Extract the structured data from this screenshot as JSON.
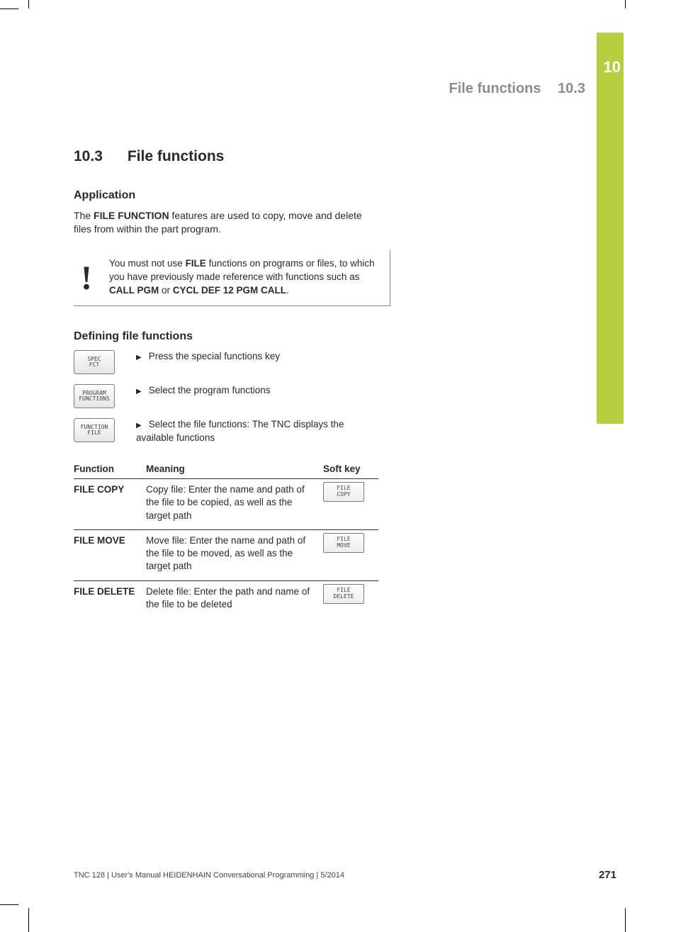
{
  "chapter_tab_number": "10",
  "running_head": {
    "title": "File functions",
    "number": "10.3"
  },
  "section": {
    "number": "10.3",
    "title": "File functions"
  },
  "application": {
    "heading": "Application",
    "intro_pre": "The ",
    "intro_bold": "FILE FUNCTION",
    "intro_post": " features are used to copy, move and delete files from within the part program."
  },
  "note": {
    "t1": "You must not use ",
    "b1": "FILE",
    "t2": " functions on programs or files, to which you have previously made reference with functions such as ",
    "b2": "CALL PGM",
    "t3": " or ",
    "b3": "CYCL DEF 12 PGM CALL",
    "t4": "."
  },
  "defining": {
    "heading": "Defining file functions",
    "steps": [
      {
        "key": "SPEC\nFCT",
        "text": "Press the special functions key"
      },
      {
        "key": "PROGRAM\nFUNCTIONS",
        "text": "Select the program functions"
      },
      {
        "key": "FUNCTION\nFILE",
        "text": "Select the file functions: The TNC displays the available functions"
      }
    ]
  },
  "table": {
    "headers": {
      "c1": "Function",
      "c2": "Meaning",
      "c3": "Soft key"
    },
    "rows": [
      {
        "fn": "FILE COPY",
        "meaning": "Copy file: Enter the name and path of the file to be copied, as well as the target path",
        "key": "FILE\nCOPY"
      },
      {
        "fn": "FILE MOVE",
        "meaning": "Move file: Enter the name and path of the file to be moved, as well as the target path",
        "key": "FILE\nMOVE"
      },
      {
        "fn": "FILE DELETE",
        "meaning": "Delete file: Enter the path and name of the file to be deleted",
        "key": "FILE\nDELETE"
      }
    ]
  },
  "footer": "TNC 128 | User's Manual HEIDENHAIN Conversational Programming | 5/2014",
  "page_number": "271"
}
